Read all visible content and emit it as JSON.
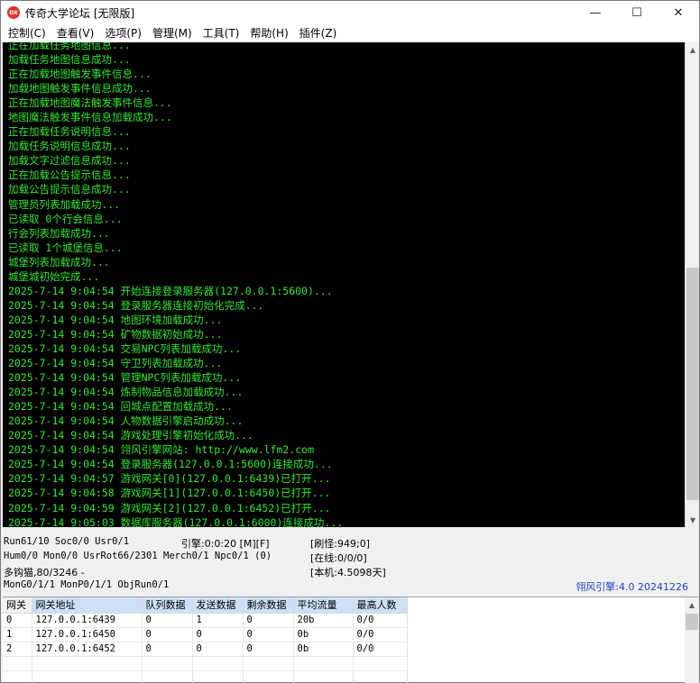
{
  "window": {
    "icon_text": "DX",
    "title": "传奇大学论坛 [无限版]",
    "minimize": "—",
    "maximize": "☐",
    "close": "✕"
  },
  "menu": [
    "控制(C)",
    "查看(V)",
    "选项(P)",
    "管理(M)",
    "工具(T)",
    "帮助(H)",
    "插件(Z)"
  ],
  "console": {
    "lines": [
      "正在加载任务地图信息...",
      "加载任务地图信息成功...",
      "正在加载地图触发事件信息...",
      "加载地图触发事件信息成功...",
      "正在加载地图魔法触发事件信息...",
      "地图魔法触发事件信息加载成功...",
      "正在加载任务说明信息...",
      "加载任务说明信息成功...",
      "加载文字过滤信息成功...",
      "正在加载公告提示信息...",
      "加载公告提示信息成功...",
      "管理员列表加载成功...",
      "已读取 0个行会信息...",
      "行会列表加载成功...",
      "已读取 1个城堡信息...",
      "城堡列表加载成功...",
      "城堡城初始完成...",
      "2025-7-14 9:04:54 开始连接登录服务器(127.0.0.1:5600)...",
      "2025-7-14 9:04:54 登录服务器连接初始化完成...",
      "2025-7-14 9:04:54 地图环境加载成功...",
      "2025-7-14 9:04:54 矿物数据初始成功...",
      "2025-7-14 9:04:54 交易NPC列表加载成功...",
      "2025-7-14 9:04:54 守卫列表加载成功...",
      "2025-7-14 9:04:54 管理NPC列表加载成功...",
      "2025-7-14 9:04:54 炼制物品信息加载成功...",
      "2025-7-14 9:04:54 回城点配置加载成功...",
      "2025-7-14 9:04:54 人物数据引擎启动成功...",
      "2025-7-14 9:04:54 游戏处理引擎初始化成功...",
      "2025-7-14 9:04:54 翎风引擎网站: http://www.lfm2.com",
      "2025-7-14 9:04:54 登录服务器(127.0.0.1:5600)连接成功...",
      "2025-7-14 9:04:57 游戏网关[0](127.0.0.1:6439)已打开...",
      "2025-7-14 9:04:58 游戏网关[1](127.0.0.1:6450)已打开...",
      "2025-7-14 9:04:59 游戏网关[2](127.0.0.1:6452)已打开...",
      "2025-7-14 9:05:03 数据库服务器(127.0.0.1:6000)连接成功..."
    ]
  },
  "status": {
    "run": "Run61/10 Soc0/0 Usr0/1",
    "engine_time": "引擎:0:0:20 [M][F]",
    "refresh": "[刷怪:949;0]",
    "hum": "Hum0/0 Mon0/0 UsrRot66/2301 Merch0/1 Npc0/1 (0)",
    "online": "[在线:0/0/0]",
    "hook": "多钩猫,80/3246 -",
    "machine": "[本机:4.5098天]",
    "mong": "MonG0/1/1 MonP0/1/1 ObjRun0/1",
    "engine_version": "翎风引擎:4.0 20241226"
  },
  "gateway_table": {
    "headers": [
      "网关",
      "网关地址",
      "队列数据",
      "发送数据",
      "剩余数据",
      "平均流量",
      "最高人数"
    ],
    "rows": [
      [
        "0",
        "127.0.0.1:6439",
        "0",
        "1",
        "0",
        "20b",
        "0/0"
      ],
      [
        "1",
        "127.0.0.1:6450",
        "0",
        "0",
        "0",
        "0b",
        "0/0"
      ],
      [
        "2",
        "127.0.0.1:6452",
        "0",
        "0",
        "0",
        "0b",
        "0/0"
      ]
    ]
  },
  "scroll": {
    "up": "▲",
    "down": "▼"
  }
}
